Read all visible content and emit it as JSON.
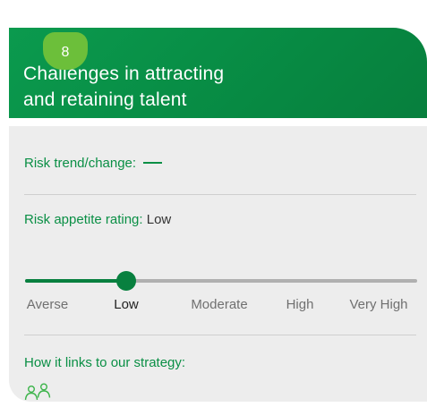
{
  "badge": {
    "number": "8"
  },
  "header": {
    "title_line1": "Challenges in attracting",
    "title_line2": "and retaining talent"
  },
  "risk_trend": {
    "label": "Risk trend/change:"
  },
  "risk_appetite": {
    "label": "Risk appetite rating:",
    "value": "Low",
    "scale": [
      "Averse",
      "Low",
      "Moderate",
      "High",
      "Very High"
    ],
    "selected_index": 1
  },
  "strategy": {
    "label": "How it links to our strategy:",
    "icon": "people-icon"
  },
  "colors": {
    "green": "#0a8f45",
    "badge": "#6cbf3a",
    "panel": "#ededed"
  }
}
